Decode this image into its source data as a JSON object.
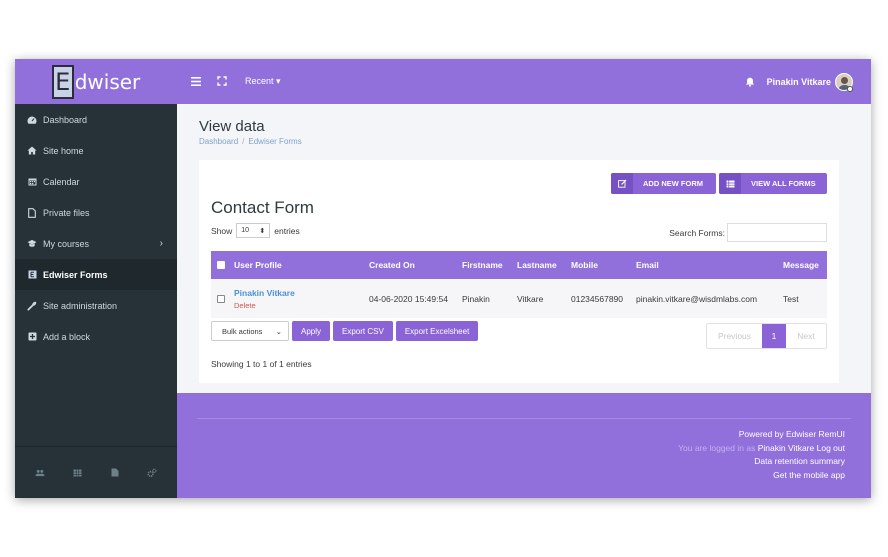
{
  "brand": {
    "letter": "E",
    "name": "dwiser"
  },
  "topbar": {
    "recent_label": "Recent",
    "username": "Pinakin Vitkare"
  },
  "sidebar": {
    "items": [
      {
        "label": "Dashboard",
        "icon": "dashboard-icon"
      },
      {
        "label": "Site home",
        "icon": "home-icon"
      },
      {
        "label": "Calendar",
        "icon": "calendar-icon"
      },
      {
        "label": "Private files",
        "icon": "file-icon"
      },
      {
        "label": "My courses",
        "icon": "graduation-cap-icon"
      },
      {
        "label": "Edwiser Forms",
        "icon": "edwiser-icon"
      },
      {
        "label": "Site administration",
        "icon": "wrench-icon"
      },
      {
        "label": "Add a block",
        "icon": "plus-square-icon"
      }
    ]
  },
  "page": {
    "title": "View data",
    "breadcrumb": [
      "Dashboard",
      "Edwiser Forms"
    ]
  },
  "card": {
    "add_new_form": "ADD NEW FORM",
    "view_all_forms": "VIEW ALL FORMS",
    "form_title": "Contact Form",
    "show_label": "Show",
    "show_value": "10",
    "entries_label": "entries",
    "search_label": "Search Forms:",
    "search_value": ""
  },
  "table": {
    "headers": [
      "User Profile",
      "Created On",
      "Firstname",
      "Lastname",
      "Mobile",
      "Email",
      "Message"
    ],
    "rows": [
      {
        "name": "Pinakin Vitkare",
        "delete": "Delete",
        "created": "04-06-2020 15:49:54",
        "firstname": "Pinakin",
        "lastname": "Vitkare",
        "mobile": "01234567890",
        "email": "pinakin.vitkare@wisdmlabs.com",
        "message": "Test"
      }
    ]
  },
  "actions": {
    "bulk": "Bulk actions",
    "apply": "Apply",
    "export_csv": "Export CSV",
    "export_excel": "Export Excelsheet"
  },
  "pagination": {
    "previous": "Previous",
    "current": "1",
    "next": "Next"
  },
  "showing": "Showing 1 to 1 of 1 entries",
  "footer": {
    "powered": "Powered by Edwiser RemUI",
    "logged_in_as": "You are logged in as",
    "user": "Pinakin Vitkare",
    "logout": "Log out",
    "retention": "Data retention summary",
    "mobile_app": "Get the mobile app"
  },
  "colors": {
    "accent": "#9270dc",
    "sidebar": "#263238",
    "link": "#4a90d9",
    "danger": "#d9534f"
  }
}
